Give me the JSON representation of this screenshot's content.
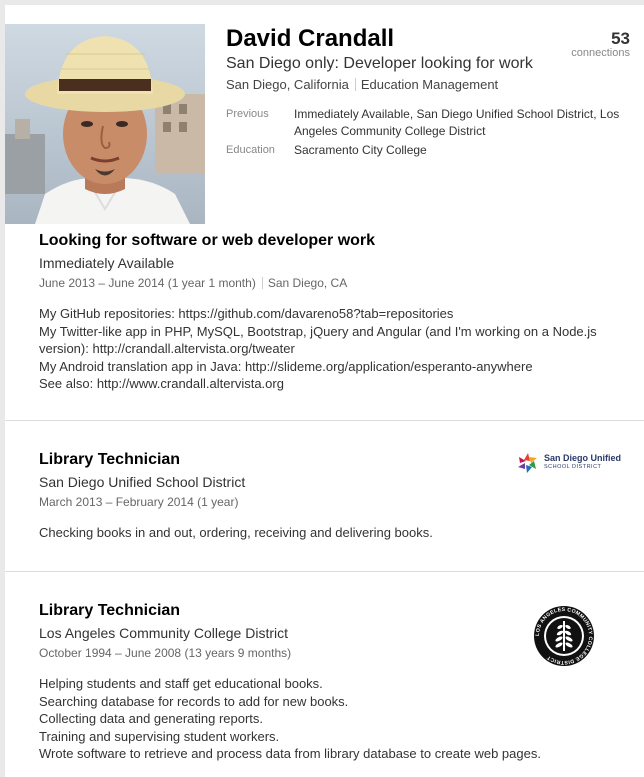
{
  "profile": {
    "name": "David Crandall",
    "headline": "San Diego only: Developer looking for work",
    "location": "San Diego, California",
    "industry": "Education Management",
    "connections_count": "53",
    "connections_label": "connections",
    "previous_label": "Previous",
    "previous_value": "Immediately Available, San Diego Unified School District, Los Angeles Community College District",
    "education_label": "Education",
    "education_value": "Sacramento City College"
  },
  "experience": [
    {
      "title": "Looking for software or web developer work",
      "org": "Immediately Available",
      "dates": "June 2013 – June 2014 (1 year 1 month)",
      "location": "San Diego, CA",
      "description": [
        "My GitHub repositories: https://github.com/davareno58?tab=repositories",
        "My Twitter-like app in PHP, MySQL, Bootstrap, jQuery and Angular (and I'm working on a Node.js",
        "version): http://crandall.altervista.org/tweater",
        "My Android translation app in Java: http://slideme.org/application/esperanto-anywhere",
        "See also: http://www.crandall.altervista.org"
      ]
    },
    {
      "title": "Library Technician",
      "org": "San Diego Unified School District",
      "dates": "March 2013 – February 2014 (1 year)",
      "description": [
        "Checking books in and out, ordering, receiving and delivering books."
      ],
      "logo_text_main": "San Diego Unified",
      "logo_text_sub": "SCHOOL DISTRICT"
    },
    {
      "title": "Library Technician",
      "org": "Los Angeles Community College District",
      "dates": "October 1994 – June 2008 (13 years 9 months)",
      "description": [
        "Helping students and staff get educational books.",
        "Searching database for records to add for new books.",
        "Collecting data and generating reports.",
        "Training and supervising student workers.",
        "Wrote software to retrieve and process data from library database to create web pages."
      ],
      "logo_text": "LOS ANGELES COMMUNITY COLLEGE DISTRICT"
    }
  ],
  "colors": {
    "page_bg": "#ffffff",
    "outer_bg": "#e9e9e9",
    "name": "#000000",
    "muted": "#888888"
  }
}
